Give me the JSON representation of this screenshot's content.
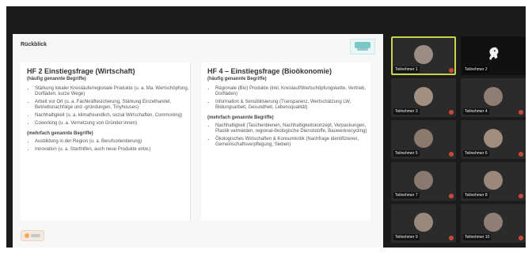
{
  "slide": {
    "title": "Rückblick",
    "left": {
      "heading": "HF 2 Einstiegsfrage (Wirtschaft)",
      "sub": "(häufig genannte Begriffe)",
      "items": [
        "Stärkung lokaler Kreisläufe/regionale Produkte (u. a. Ma. Wertschöpfung, Dorfläden, kurze Wege)",
        "Arbeit vor Ort (u. a. Fachkräftesicherung, Stärkung Einzelhandel, Betriebsnachfolge und -gründungen, Tinyhouses)",
        "Nachhaltigkeit (u. a. klimafreundlich, sozial Wirtschaften, Commoning)",
        "Coworking (u. a. Vernetzung von Gründer:innen)"
      ],
      "section2": "(mehrfach genannte Begriffe)",
      "items2": [
        "Ausbildung in der Region (u. a. Berufsorientierung)",
        "Innovation (u. a. Starthilfen, auch neue Produkte entw.)"
      ]
    },
    "right": {
      "heading": "HF 4 – Einstiegsfrage (Bioökonomie)",
      "sub": "(häufig genannte Begriffe)",
      "items": [
        "Regionale (Bio) Produkte (inkl. Kreislauf/Wertschöpfungskette, Vertrieb, Dorfläden)",
        "Information & Sensibilisierung (Transparenz, Wertschätzung LW, Bildungsarbeit, Gesundheit, Lebensqualität)"
      ],
      "section2": "(mehrfach genannte Begriffe)",
      "items2": [
        "Nachhaltigkeit (Taschenbienen, Nachhaltigkeitskonzept, Verpackungen, Plastik vermeiden, regional-ökologische Dienststoffe, Bauwerkrecycling)",
        "Ökologisches Wirtschaften & Konsumkritik (Nachfrage identifizieren, Gemeinschaftsverpflegung, Sieben)"
      ]
    }
  },
  "participants": [
    {
      "label": "Teilnehmer 1",
      "active": true,
      "avatar_type": "person"
    },
    {
      "label": "Teilnehmer 2",
      "active": false,
      "avatar_type": "horse"
    },
    {
      "label": "Teilnehmer 3",
      "active": false,
      "avatar_type": "person"
    },
    {
      "label": "Teilnehmer 4",
      "active": false,
      "avatar_type": "person"
    },
    {
      "label": "Teilnehmer 5",
      "active": false,
      "avatar_type": "person"
    },
    {
      "label": "Teilnehmer 6",
      "active": false,
      "avatar_type": "person"
    },
    {
      "label": "Teilnehmer 7",
      "active": false,
      "avatar_type": "person"
    },
    {
      "label": "Teilnehmer 8",
      "active": false,
      "avatar_type": "person"
    },
    {
      "label": "Teilnehmer 9",
      "active": false,
      "avatar_type": "person"
    },
    {
      "label": "Teilnehmer 10",
      "active": false,
      "avatar_type": "person"
    }
  ],
  "colors": {
    "background": "#1b1b1b",
    "slide": "#f7f7f7",
    "active_outline": "#c7d34a",
    "mic_muted": "#d94d3b"
  }
}
